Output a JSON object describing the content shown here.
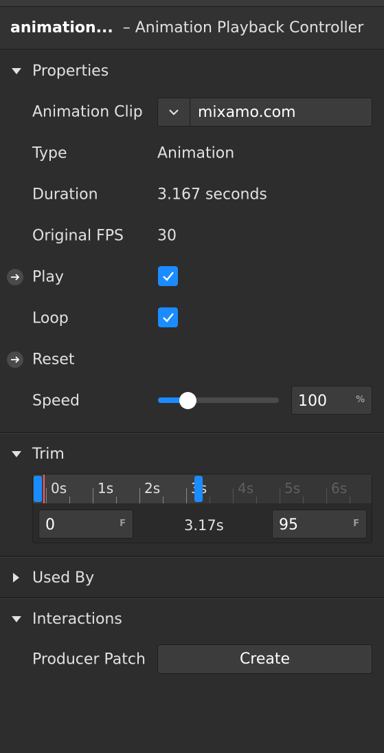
{
  "header": {
    "object_name": "animation...",
    "object_type": "– Animation Playback Controller"
  },
  "properties": {
    "section_label": "Properties",
    "animation_clip": {
      "label": "Animation Clip",
      "value": "mixamo.com"
    },
    "type": {
      "label": "Type",
      "value": "Animation"
    },
    "duration": {
      "label": "Duration",
      "value": "3.167 seconds"
    },
    "original_fps": {
      "label": "Original FPS",
      "value": "30"
    },
    "play": {
      "label": "Play",
      "checked": true
    },
    "loop": {
      "label": "Loop",
      "checked": true
    },
    "reset": {
      "label": "Reset"
    },
    "speed": {
      "label": "Speed",
      "value": "100",
      "unit": "%",
      "slider_fraction": 0.25
    }
  },
  "trim": {
    "section_label": "Trim",
    "timeline_labels": [
      "0s",
      "1s",
      "2s",
      "3s",
      "4s",
      "5s",
      "6s"
    ],
    "start_frame": "0",
    "end_frame": "95",
    "frame_unit": "F",
    "duration_label": "3.17s"
  },
  "used_by": {
    "section_label": "Used By"
  },
  "interactions": {
    "section_label": "Interactions",
    "producer_patch": {
      "label": "Producer Patch",
      "button": "Create"
    }
  },
  "colors": {
    "accent": "#1a8cff",
    "background": "#2d2d2d",
    "playhead": "#ff5a66"
  }
}
